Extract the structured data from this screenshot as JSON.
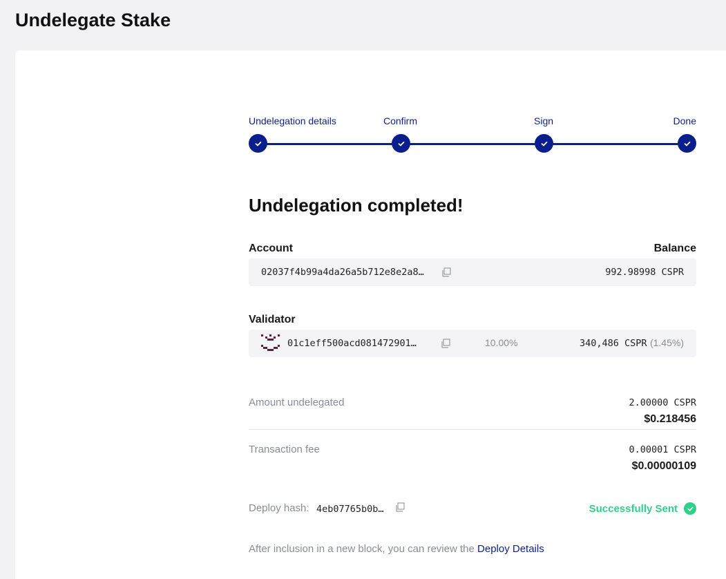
{
  "page_title": "Undelegate Stake",
  "stepper": {
    "steps": [
      {
        "label": "Undelegation details",
        "icon": "check-icon"
      },
      {
        "label": "Confirm",
        "icon": "check-icon"
      },
      {
        "label": "Sign",
        "icon": "check-icon"
      },
      {
        "label": "Done",
        "icon": "check-icon"
      }
    ],
    "accent_color": "#0b1f8c"
  },
  "heading": "Undelegation completed!",
  "account": {
    "label": "Account",
    "balance_label": "Balance",
    "public_key": "02037f4b99a4da26a5b712e8e2a8…",
    "balance": "992.98998 CSPR"
  },
  "validator": {
    "label": "Validator",
    "public_key": "01c1eff500acd081472901…",
    "fee": "10.00%",
    "total_stake": "340,486 CSPR",
    "stake_share": "(1.45%)",
    "avatar_color": "#5a1f3a"
  },
  "amount": {
    "label": "Amount undelegated",
    "cspr": "2.00000 CSPR",
    "usd": "$0.218456"
  },
  "fee": {
    "label": "Transaction fee",
    "cspr": "0.00001 CSPR",
    "usd": "$0.00000109"
  },
  "deploy": {
    "label": "Deploy hash:",
    "hash": "4eb07765b0b…",
    "status": "Successfully Sent",
    "status_color": "#2fd08a"
  },
  "footer": {
    "text": "After inclusion in a new block, you can review the ",
    "link_text": "Deploy Details"
  }
}
